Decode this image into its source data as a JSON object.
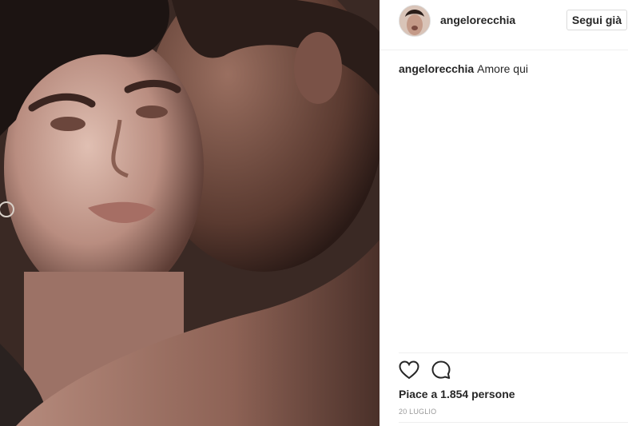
{
  "post": {
    "username": "angelorecchia",
    "follow_label": "Segui già",
    "caption_user": "angelorecchia",
    "caption_text": "Amore qui",
    "likes_text": "Piace a 1.854 persone",
    "date": "20 LUGLIO"
  },
  "icons": {
    "like": "heart-icon",
    "comment": "comment-icon"
  },
  "colors": {
    "text": "#262626",
    "muted": "#999999",
    "border": "#dbdbdb"
  }
}
